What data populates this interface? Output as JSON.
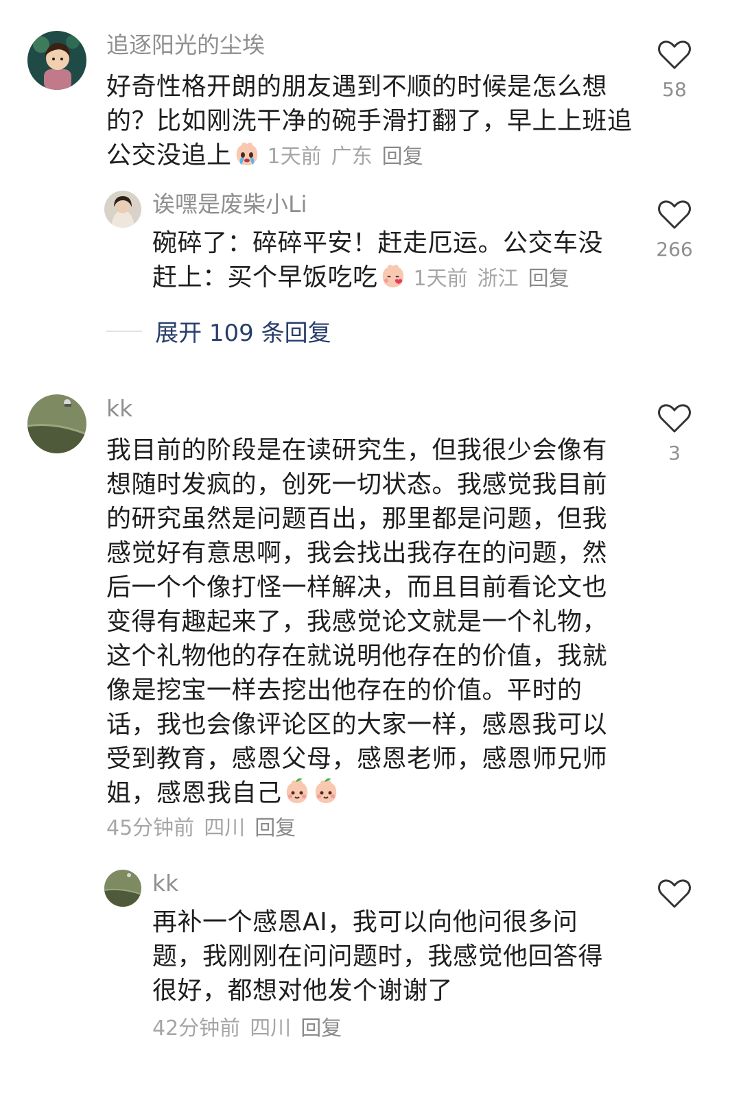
{
  "comments": [
    {
      "username": "追逐阳光的尘埃",
      "text": "好奇性格开朗的朋友遇到不顺的时候是怎么想的？比如刚洗干净的碗手滑打翻了，早上上班追公交没追上",
      "emoji": "crying-peach-emoji",
      "time": "1天前",
      "location": "广东",
      "reply_label": "回复",
      "likes": "58"
    },
    {
      "username": "诶嘿是废柴小Li",
      "text": "碗碎了：碎碎平安！赶走厄运。公交车没赶上：买个早饭吃吃",
      "emoji": "kissing-peach-emoji",
      "time": "1天前",
      "location": "浙江",
      "reply_label": "回复",
      "likes": "266"
    },
    {
      "username": "kk",
      "text": "我目前的阶段是在读研究生，但我很少会像有想随时发疯的，创死一切状态。我感觉我目前的研究虽然是问题百出，那里都是问题，但我感觉好有意思啊，我会找出我存在的问题，然后一个个像打怪一样解决，而且目前看论文也变得有趣起来了，我感觉论文就是一个礼物，这个礼物他的存在就说明他存在的价值，我就像是挖宝一样去挖出他存在的价值。平时的话，我也会像评论区的大家一样，感恩我可以受到教育，感恩父母，感恩老师，感恩师兄师姐，感恩我自己",
      "emoji": "smiling-peach-emoji",
      "time": "45分钟前",
      "location": "四川",
      "reply_label": "回复",
      "likes": "3"
    },
    {
      "username": "kk",
      "text": "再补一个感恩AI，我可以向他问很多问题，我刚刚在问问题时，我感觉他回答得很好，都想对他发个谢谢了",
      "time": "42分钟前",
      "location": "四川",
      "reply_label": "回复",
      "likes": ""
    }
  ],
  "expand_replies": "展开 109 条回复",
  "colors": {
    "accent_link": "#283e6b",
    "meta_gray": "#a6a6a6",
    "name_gray": "#8f8f8f"
  }
}
